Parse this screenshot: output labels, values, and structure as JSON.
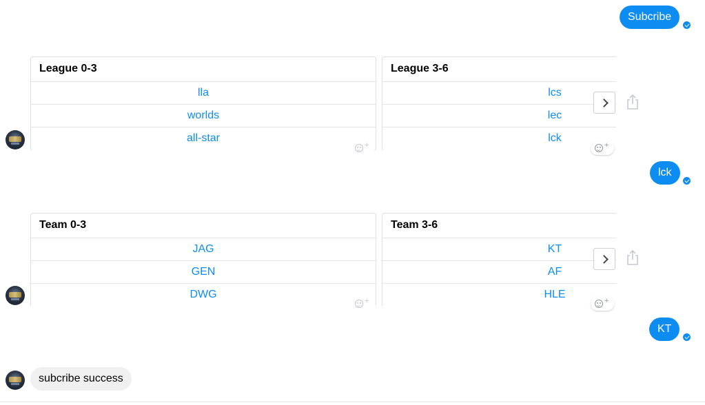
{
  "messages": {
    "subscribe": "Subcribe",
    "lck": "lck",
    "kt": "KT",
    "success": "subcribe success"
  },
  "league_carousel": {
    "cards": [
      {
        "title": "League 0-3",
        "buttons": [
          "lla",
          "worlds",
          "all-star"
        ]
      },
      {
        "title": "League 3-6",
        "buttons": [
          "lcs",
          "lec",
          "lck"
        ]
      }
    ]
  },
  "team_carousel": {
    "cards": [
      {
        "title": "Team 0-3",
        "buttons": [
          "JAG",
          "GEN",
          "DWG"
        ]
      },
      {
        "title": "Team 3-6",
        "buttons": [
          "KT",
          "AF",
          "HLE"
        ]
      }
    ]
  },
  "icons": {
    "read_receipt": "check-circle-icon",
    "next": "chevron-right-icon",
    "share": "share-icon",
    "reaction": "add-reaction-icon",
    "avatar": "league-logo-avatar"
  },
  "colors": {
    "accent": "#0d8cf2",
    "incoming_bubble": "#f1f0f0",
    "card_border": "#dddfe2"
  }
}
